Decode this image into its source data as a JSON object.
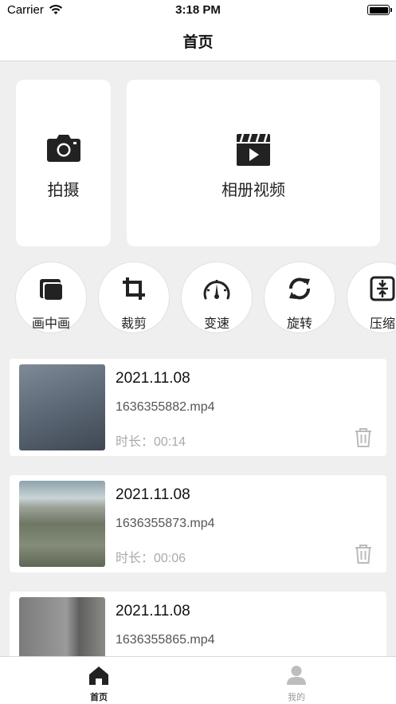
{
  "status_bar": {
    "carrier": "Carrier",
    "time": "3:18 PM"
  },
  "nav": {
    "title": "首页"
  },
  "actions": {
    "shoot": {
      "label": "拍摄",
      "icon": "camera-icon"
    },
    "album": {
      "label": "相册视频",
      "icon": "clapperboard-icon"
    }
  },
  "tools": [
    {
      "label": "画中画",
      "icon": "picture-in-picture-icon"
    },
    {
      "label": "裁剪",
      "icon": "crop-icon"
    },
    {
      "label": "变速",
      "icon": "speedometer-icon"
    },
    {
      "label": "旋转",
      "icon": "rotate-icon"
    },
    {
      "label": "压缩",
      "icon": "compress-icon"
    }
  ],
  "videos": [
    {
      "date": "2021.11.08",
      "file": "1636355882.mp4",
      "duration": "时长：00:14"
    },
    {
      "date": "2021.11.08",
      "file": "1636355873.mp4",
      "duration": "时长：00:06"
    },
    {
      "date": "2021.11.08",
      "file": "1636355865.mp4",
      "duration": ""
    }
  ],
  "tabbar": {
    "home": {
      "label": "首页",
      "icon": "home-icon"
    },
    "mine": {
      "label": "我的",
      "icon": "user-icon"
    }
  }
}
